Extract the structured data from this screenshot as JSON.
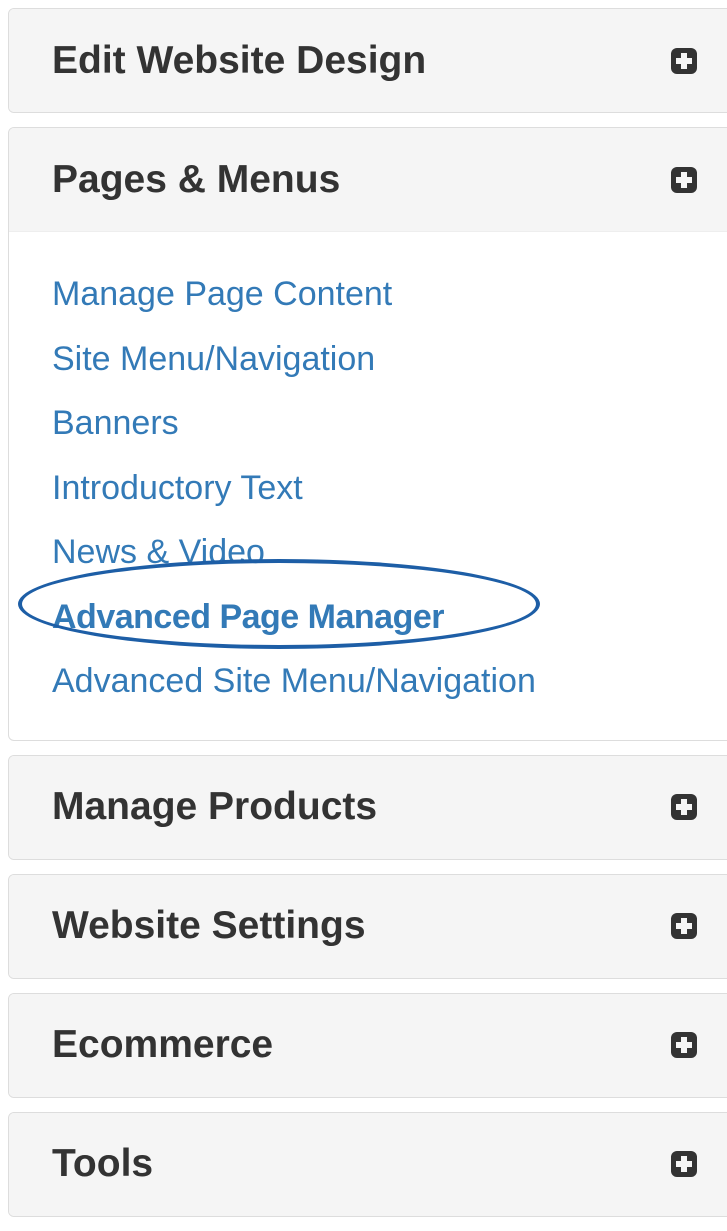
{
  "sections": [
    {
      "title": "Edit Website Design",
      "icon": "plus-square-icon"
    },
    {
      "title": "Pages & Menus",
      "icon": "plus-square-icon",
      "items": [
        {
          "label": "Manage Page Content"
        },
        {
          "label": "Site Menu/Navigation"
        },
        {
          "label": "Banners"
        },
        {
          "label": "Introductory Text"
        },
        {
          "label": "News & Video"
        },
        {
          "label": "Advanced Page Manager",
          "highlighted": true
        },
        {
          "label": "Advanced Site Menu/Navigation"
        }
      ]
    },
    {
      "title": "Manage Products",
      "icon": "plus-square-icon"
    },
    {
      "title": "Website Settings",
      "icon": "plus-square-icon"
    },
    {
      "title": "Ecommerce",
      "icon": "plus-square-icon"
    },
    {
      "title": "Tools",
      "icon": "plus-square-icon"
    }
  ],
  "colors": {
    "heading_bg": "#f5f5f5",
    "heading_text": "#333333",
    "link": "#337ab7",
    "highlight_oval": "#1d5ea6",
    "border": "#dddddd"
  }
}
